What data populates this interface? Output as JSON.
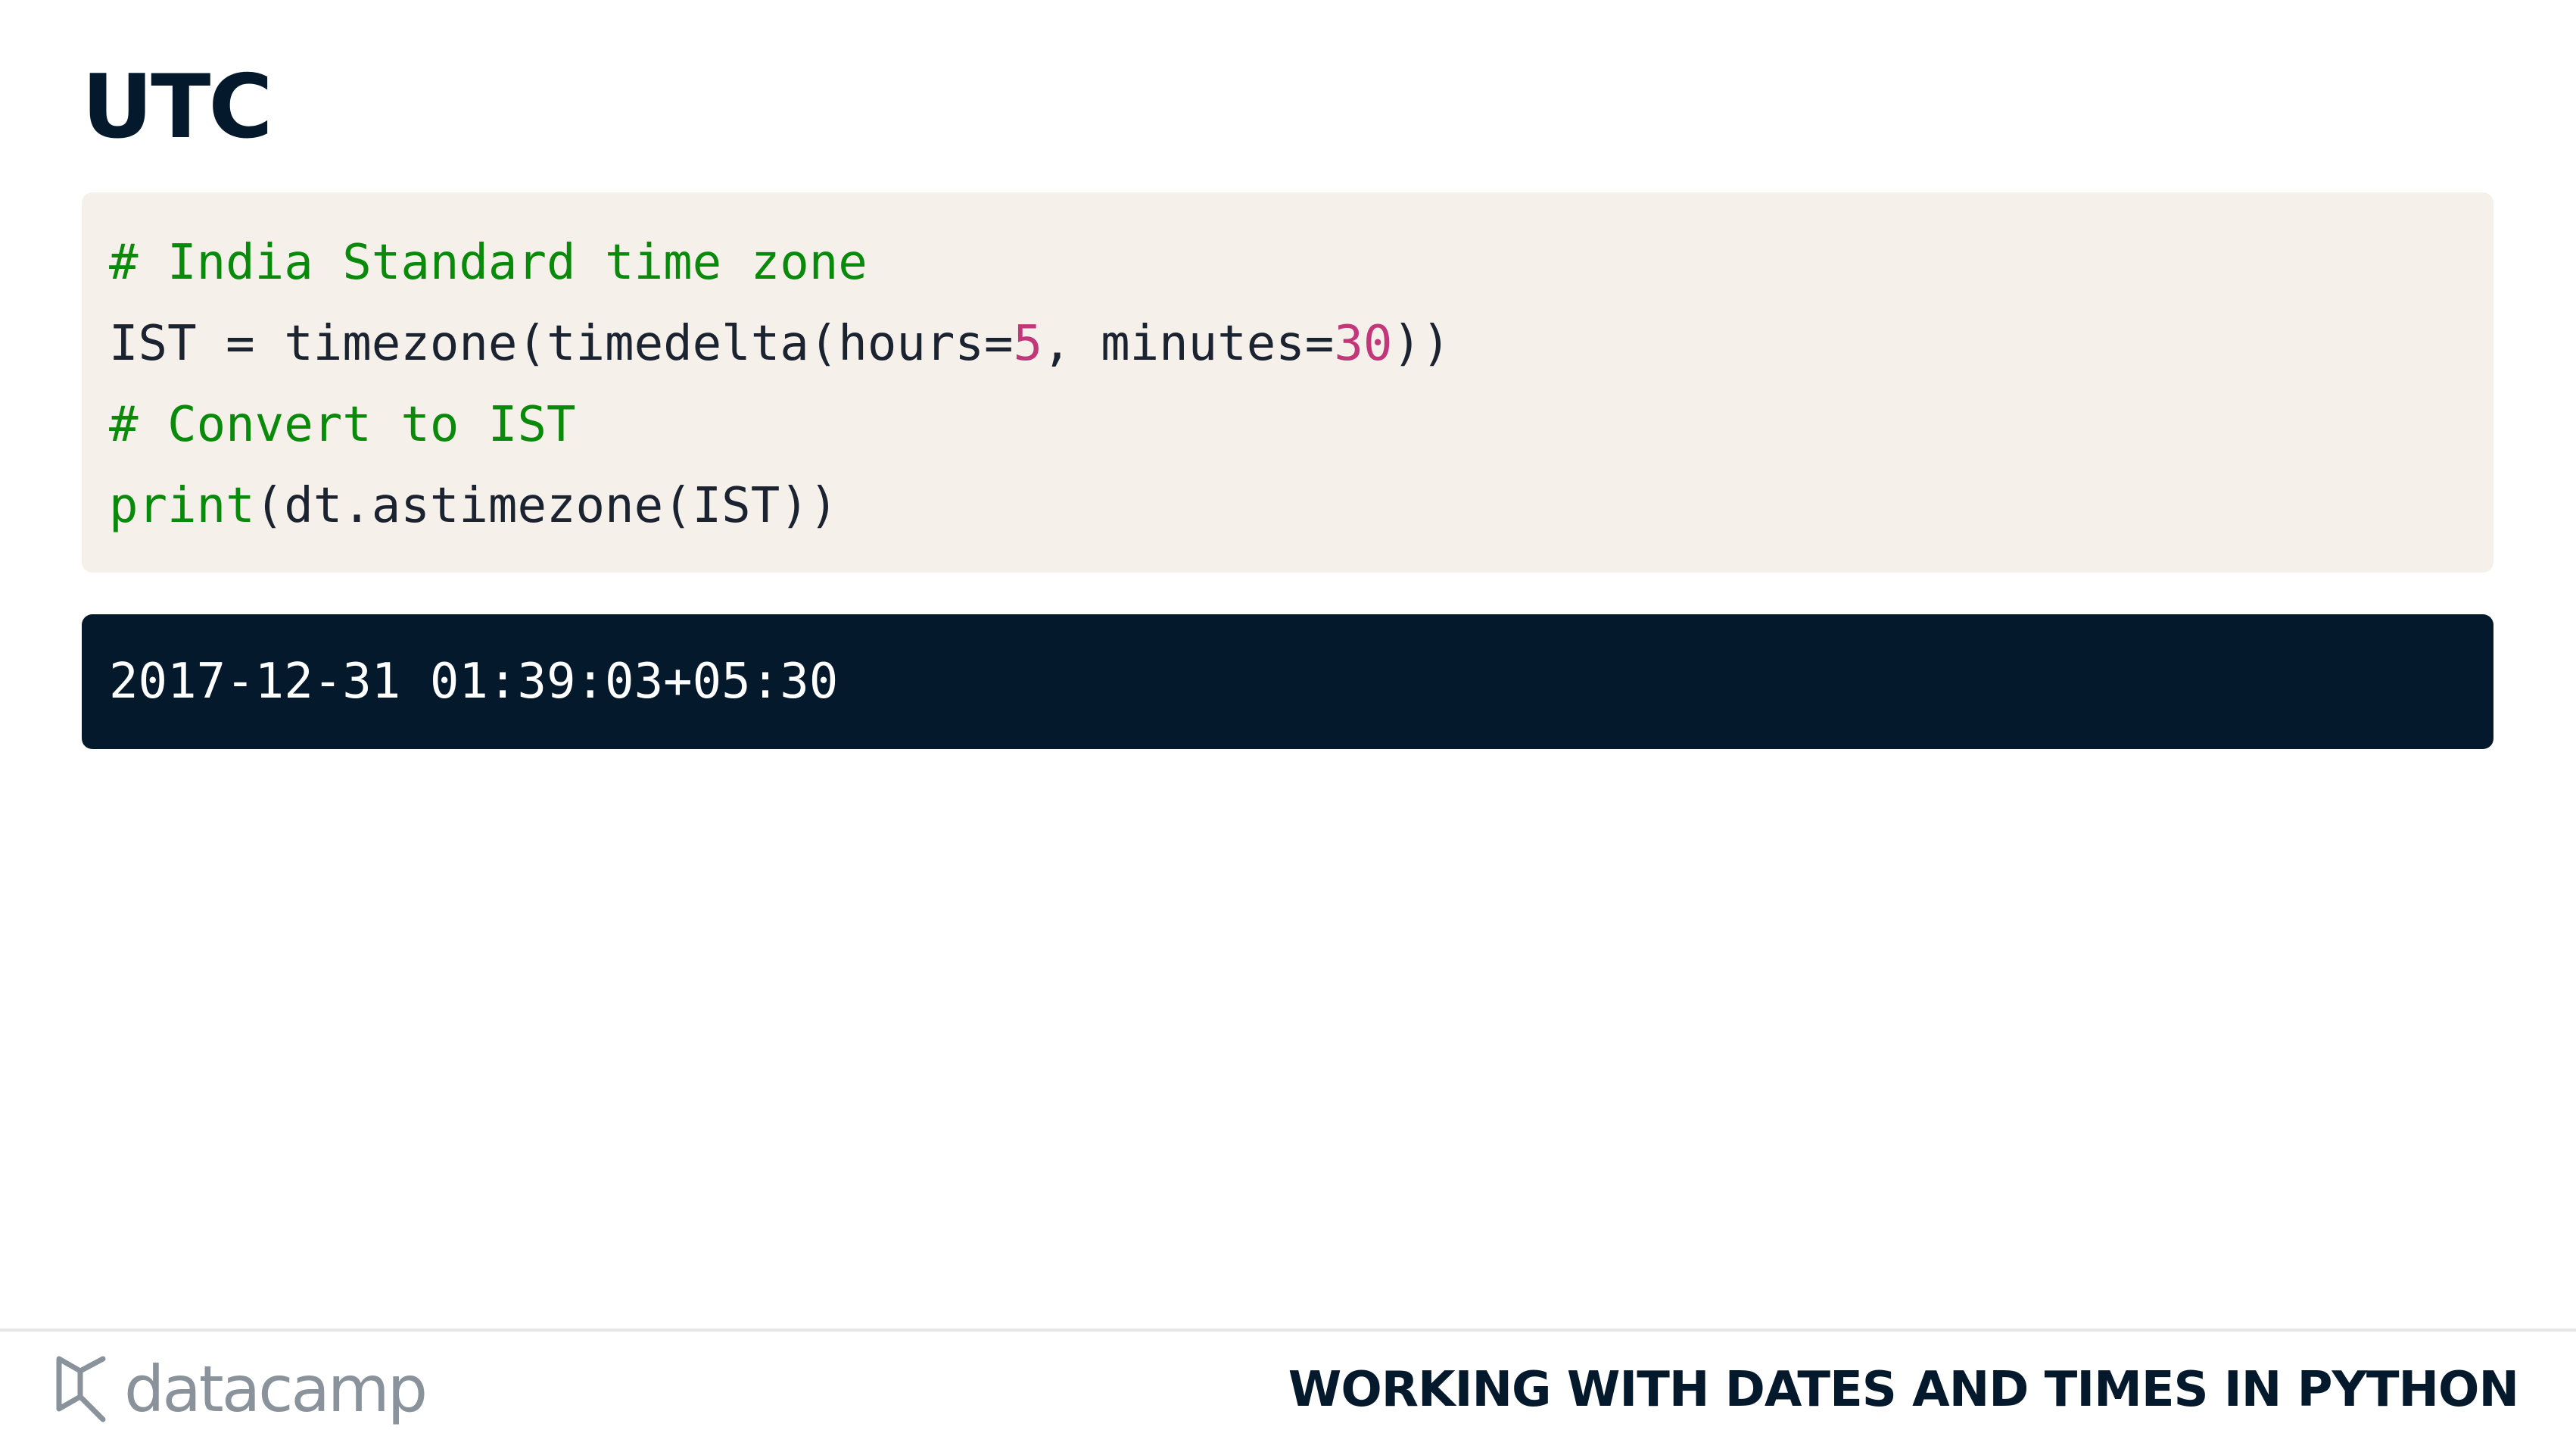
{
  "slide": {
    "title": "UTC"
  },
  "code": {
    "line1_comment": "# India Standard time zone",
    "line2_a": "IST = timezone(timedelta(hours=",
    "line2_num1": "5",
    "line2_b": ", minutes=",
    "line2_num2": "30",
    "line2_c": "))",
    "line3_comment": "# Convert to IST",
    "line4_builtin": "print",
    "line4_rest": "(dt.astimezone(IST))"
  },
  "output": {
    "text": "2017-12-31 01:39:03+05:30"
  },
  "footer": {
    "logo_text": "datacamp",
    "logo_icon": "datacamp-logo-icon",
    "course_title": "WORKING WITH DATES AND TIMES IN PYTHON"
  },
  "colors": {
    "title": "#05192d",
    "code_background": "#f5f1ea",
    "output_background": "#05192d",
    "comment": "#0a8a0a",
    "number": "#c2367a"
  }
}
